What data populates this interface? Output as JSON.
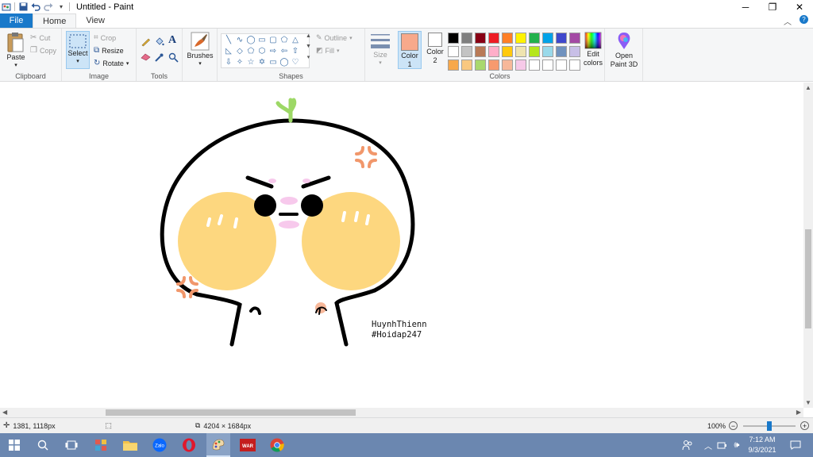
{
  "window": {
    "title": "Untitled - Paint"
  },
  "tabs": {
    "file": "File",
    "home": "Home",
    "view": "View"
  },
  "clipboard": {
    "paste": "Paste",
    "cut": "Cut",
    "copy": "Copy",
    "label": "Clipboard"
  },
  "image": {
    "select": "Select",
    "crop": "Crop",
    "resize": "Resize",
    "rotate": "Rotate",
    "label": "Image"
  },
  "tools": {
    "label": "Tools"
  },
  "brushes": {
    "label": "Brushes"
  },
  "shapes": {
    "outline": "Outline",
    "fill": "Fill",
    "label": "Shapes"
  },
  "size": {
    "label": "Size"
  },
  "colors": {
    "color1_label": "Color",
    "color1_num": "1",
    "color2_label": "Color",
    "color2_num": "2",
    "edit_label1": "Edit",
    "edit_label2": "colors",
    "label": "Colors",
    "color1_value": "#f7a98b",
    "color2_value": "#ffffff",
    "palette": [
      "#000000",
      "#7f7f7f",
      "#880015",
      "#ed1c24",
      "#ff7f27",
      "#fff200",
      "#22b14c",
      "#00a2e8",
      "#3f48cc",
      "#a349a4",
      "#ffffff",
      "#c3c3c3",
      "#b97a57",
      "#ffaec9",
      "#ffc90e",
      "#efe4b0",
      "#b5e61d",
      "#99d9ea",
      "#7092be",
      "#c8bfe7",
      "#f7a84b",
      "#f9c880",
      "#a9d86e",
      "#f79a6e",
      "#f7b89a",
      "#f6c9e8",
      "#ffffff",
      "#ffffff",
      "#ffffff",
      "#ffffff"
    ]
  },
  "paint3d": {
    "label1": "Open",
    "label2": "Paint 3D"
  },
  "canvas": {
    "signature_line1": "HuynhThienn",
    "signature_line2": "#Hoidap247"
  },
  "status": {
    "cursor_pos": "1381, 1118px",
    "image_size": "4204 × 1684px",
    "zoom": "100%"
  },
  "taskbar": {
    "time": "7:12 AM",
    "date": "9/3/2021"
  }
}
